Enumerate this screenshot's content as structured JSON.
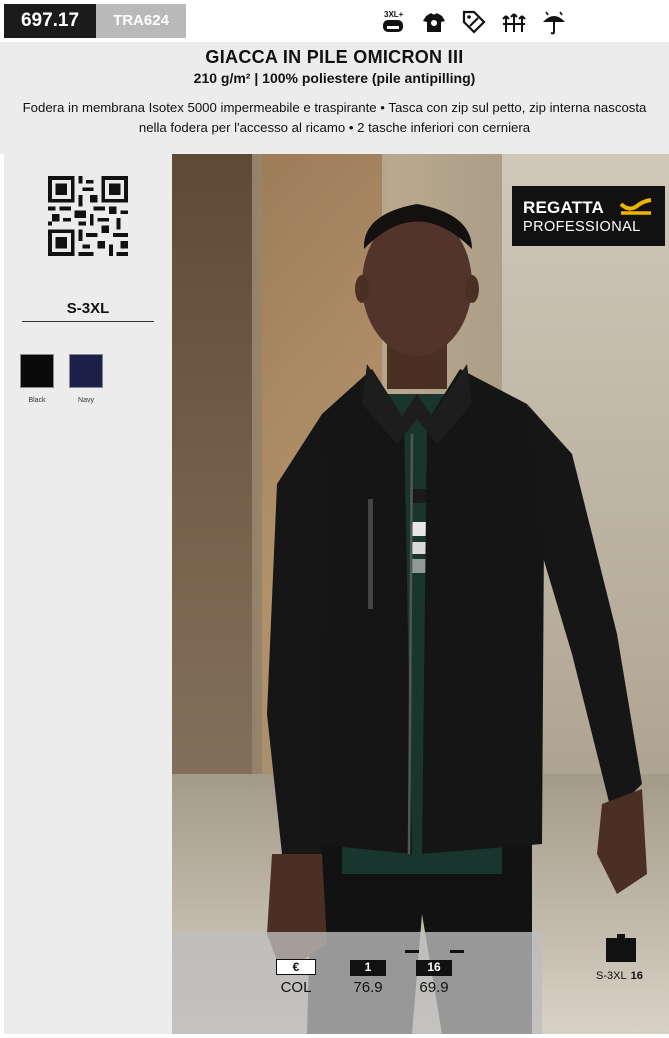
{
  "codes": {
    "main": "697.17",
    "sku": "TRA624"
  },
  "feature_icons": [
    "size-3xl-plus-icon",
    "tshirt-icon",
    "tag-discount-icon",
    "lightweight-icon",
    "waterproof-icon"
  ],
  "feature_icon_text": "3XL+",
  "product": {
    "title": "GIACCA IN PILE OMICRON III",
    "subtitle": "210 g/m² | 100% poliestere (pile antipilling)",
    "description": "Fodera in membrana Isotex 5000 impermeabile e traspirante • Tasca con zip sul petto, zip interna nascosta nella fodera per l'accesso al ricamo • 2 tasche inferiori con cerniera"
  },
  "sizes": "S-3XL",
  "colors": [
    {
      "name": "Black",
      "hex": "#0a0a0a"
    },
    {
      "name": "Navy",
      "hex": "#1c2149"
    }
  ],
  "brand": {
    "line1": "REGATTA",
    "line2": "PROFESSIONAL",
    "accent": "#f0b400"
  },
  "pricing": {
    "currency_label": "€",
    "currency_value": "COL",
    "tiers": [
      {
        "qty": "1",
        "price": "76.9"
      },
      {
        "qty": "16",
        "price": "69.9"
      }
    ]
  },
  "carton": {
    "sizes": "S-3XL",
    "qty": "16"
  }
}
